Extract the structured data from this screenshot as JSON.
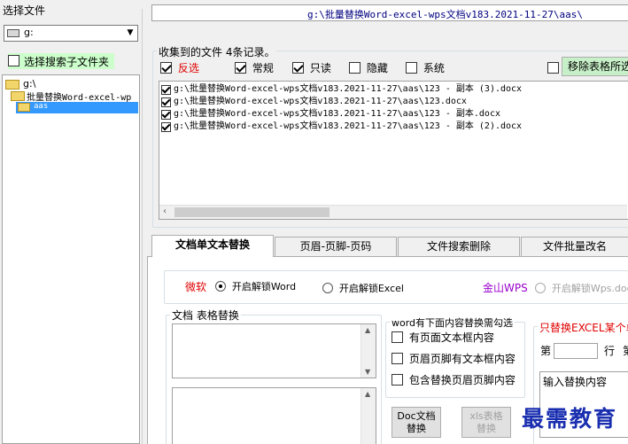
{
  "left_panel": {
    "title": "选择文件",
    "drive_value": "g:",
    "subfolder_checkbox_label": "选择搜索子文件夹",
    "tree": [
      {
        "label": "g:\\",
        "level": 0
      },
      {
        "label": "批量替换Word-excel-wp",
        "level": 1
      },
      {
        "label": "aas",
        "level": 2,
        "selected": true
      }
    ]
  },
  "path_bar": {
    "text": "g:\\批量替换Word-excel-wps文档v183.2021-11-27\\aas\\"
  },
  "collected": {
    "title": "收集到的文件 4条记录。",
    "filters": [
      {
        "label": "反选",
        "checked": true,
        "accent": true
      },
      {
        "label": "常规",
        "checked": true
      },
      {
        "label": "只读",
        "checked": true
      },
      {
        "label": "隐藏",
        "checked": false
      },
      {
        "label": "系统",
        "checked": false
      }
    ],
    "remove_button": "移除表格所选",
    "files": [
      "g:\\批量替换Word-excel-wps文档v183.2021-11-27\\aas\\123 - 副本 (3).docx",
      "g:\\批量替换Word-excel-wps文档v183.2021-11-27\\aas\\123.docx",
      "g:\\批量替换Word-excel-wps文档v183.2021-11-27\\aas\\123 - 副本.docx",
      "g:\\批量替换Word-excel-wps文档v183.2021-11-27\\aas\\123 - 副本 (2).docx"
    ]
  },
  "tabs": [
    "文档单文本替换",
    "页眉-页脚-页码",
    "文件搜索删除",
    "文件批量改名"
  ],
  "tab_content": {
    "ms_label": "微软",
    "word_radio": "开启解锁Word",
    "excel_radio": "开启解锁Excel",
    "wps_label": "金山WPS",
    "wps_radio": "开启解锁Wps.doc",
    "table_group_title": "文档 表格替换",
    "word_group_title": "word有下面内容替换需勾选",
    "word_options": [
      "有页面文本框内容",
      "页眉页脚有文本框内容",
      "包含替换页眉页脚内容"
    ],
    "doc_button": "Doc文档\n替换",
    "xls_button": "xls表格\n替换",
    "excel_group_title": "只替换EXCEL某个单",
    "row_label_prefix": "第",
    "row_label_suffix": "行",
    "row_label_tail": "第",
    "input_replace": "输入替换内容"
  },
  "watermark": "最需教育",
  "colors": {
    "accent_red": "#e00000",
    "purple": "#9900cc",
    "green_button": "#c8f0c8",
    "selection": "#3399ff"
  }
}
